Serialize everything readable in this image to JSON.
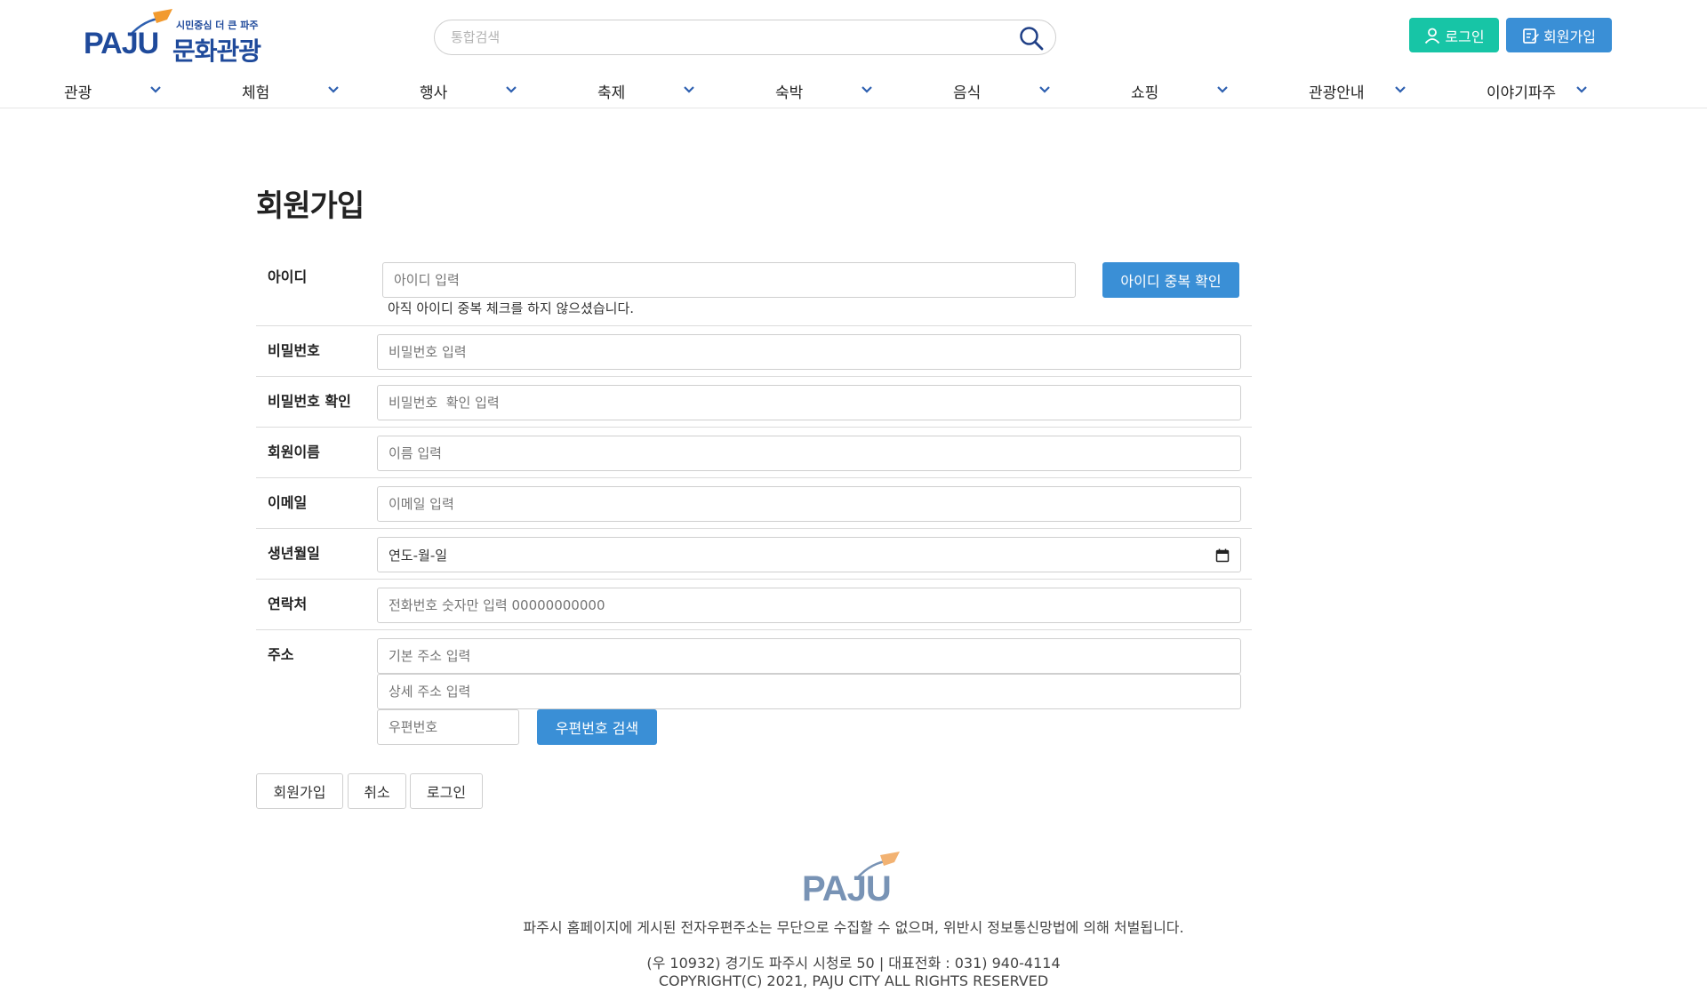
{
  "header": {
    "logo_brand": "PAJU",
    "logo_tagline_small": "시민중심 더 큰 파주",
    "logo_tagline_main": "문화관광",
    "search_placeholder": "통합검색",
    "login_label": "로그인",
    "join_label": "회원가입"
  },
  "nav": [
    {
      "label": "관광"
    },
    {
      "label": "체험"
    },
    {
      "label": "행사"
    },
    {
      "label": "축제"
    },
    {
      "label": "숙박"
    },
    {
      "label": "음식"
    },
    {
      "label": "쇼핑"
    },
    {
      "label": "관광안내"
    },
    {
      "label": "이야기파주"
    }
  ],
  "form": {
    "title": "회원가입",
    "id_label": "아이디",
    "id_placeholder": "아이디 입력",
    "id_check_button": "아이디 중복 확인",
    "id_hint": "아직 아이디 중복 체크를 하지 않으셨습니다.",
    "password_label": "비밀번호",
    "password_placeholder": "비밀번호 입력",
    "password_confirm_label": "비밀번호 확인",
    "password_confirm_placeholder": "비밀번호  확인 입력",
    "name_label": "회원이름",
    "name_placeholder": "이름 입력",
    "email_label": "이메일",
    "email_placeholder": "이메일 입력",
    "birth_label": "생년월일",
    "birth_value": "연도-월-일",
    "phone_label": "연락처",
    "phone_placeholder": "전화번호 숫자만 입력 00000000000",
    "address_label": "주소",
    "address_base_placeholder": "기본 주소 입력",
    "address_detail_placeholder": "상세 주소 입력",
    "zipcode_placeholder": "우편번호",
    "zipcode_search_button": "우편번호 검색"
  },
  "actions": {
    "join": "회원가입",
    "cancel": "취소",
    "login": "로그인"
  },
  "footer": {
    "logo_brand": "PAJU",
    "notice": "파주시 홈페이지에 게시된 전자우편주소는 무단으로 수집할 수 없으며, 위반시 정보통신망법에 의해 처벌됩니다.",
    "address": "(우 10932) 경기도 파주시 시청로 50 | 대표전화 : 031) 940-4114",
    "copyright": "COPYRIGHT(C) 2021, PAJU CITY ALL RIGHTS RESERVED"
  },
  "colors": {
    "login_button": "#17c5a6",
    "primary_blue": "#3a8fd6",
    "logo_blue": "#1f4a9b",
    "nav_chevron": "#2d5fb0"
  }
}
